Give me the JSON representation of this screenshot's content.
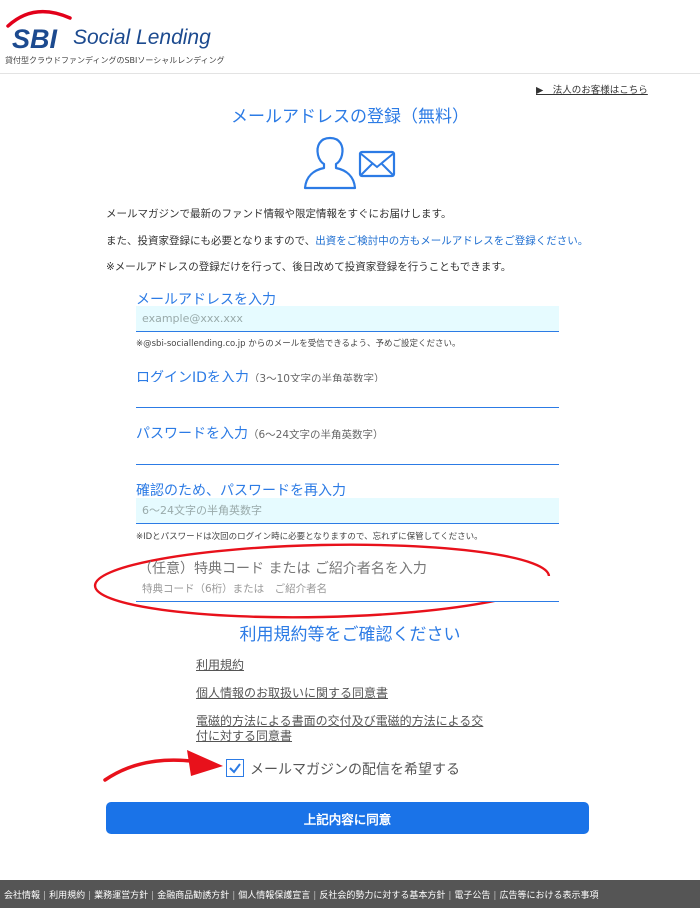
{
  "header": {
    "logo_text": "SBI",
    "brand_name": "Social Lending",
    "tagline": "貸付型クラウドファンディングのSBIソーシャルレンディング",
    "corporate_link": "▶　法人のお客様はこちら"
  },
  "page": {
    "title": "メールアドレスの登録（無料）",
    "intro_1": "メールマガジンで最新のファンド情報や限定情報をすぐにお届けします。",
    "intro_2_pre": "また、投資家登録にも必要となりますので、",
    "intro_2_link": "出資をご検討中の方もメールアドレスをご登録ください。",
    "intro_3": "※メールアドレスの登録だけを行って、後日改めて投資家登録を行うこともできます。"
  },
  "form": {
    "email": {
      "label": "メールアドレスを入力",
      "placeholder": "example@xxx.xxx",
      "note": "※@sbi-sociallending.co.jp からのメールを受信できるよう、予めご設定ください。"
    },
    "login_id": {
      "label": "ログインIDを入力",
      "hint": "（3～10文字の半角英数字）"
    },
    "password": {
      "label": "パスワードを入力",
      "hint": "（6～24文字の半角英数字）"
    },
    "password_confirm": {
      "label": "確認のため、パスワードを再入力",
      "placeholder": "6～24文字の半角英数字",
      "note": "※IDとパスワードは次回のログイン時に必要となりますので、忘れずに保管してください。"
    },
    "referral": {
      "label": "（任意）特典コード または ご紹介者名を入力",
      "placeholder": "特典コード（6桁）または　ご紹介者名"
    }
  },
  "terms": {
    "title": "利用規約等をご確認ください",
    "links": [
      "利用規約",
      "個人情報のお取扱いに関する同意書",
      "電磁的方法による書面の交付及び電磁的方法による交",
      "付に対する同意書"
    ],
    "newsletter_checkbox": {
      "label": "メールマガジンの配信を希望する",
      "checked": true
    },
    "agree_button": "上記内容に同意"
  },
  "footer": {
    "links": [
      "会社情報",
      "利用規約",
      "業務運営方針",
      "金融商品勧誘方針",
      "個人情報保護宣言",
      "反社会的勢力に対する基本方針",
      "電子公告",
      "広告等における表示事項"
    ]
  },
  "colors": {
    "accent": "#2c7be5",
    "button": "#1a73e8",
    "annotation": "#e8111b",
    "input_fill": "#e6fbff",
    "footer": "#555555"
  },
  "icons": [
    "person-outline-icon",
    "envelope-icon",
    "checkmark-icon"
  ]
}
